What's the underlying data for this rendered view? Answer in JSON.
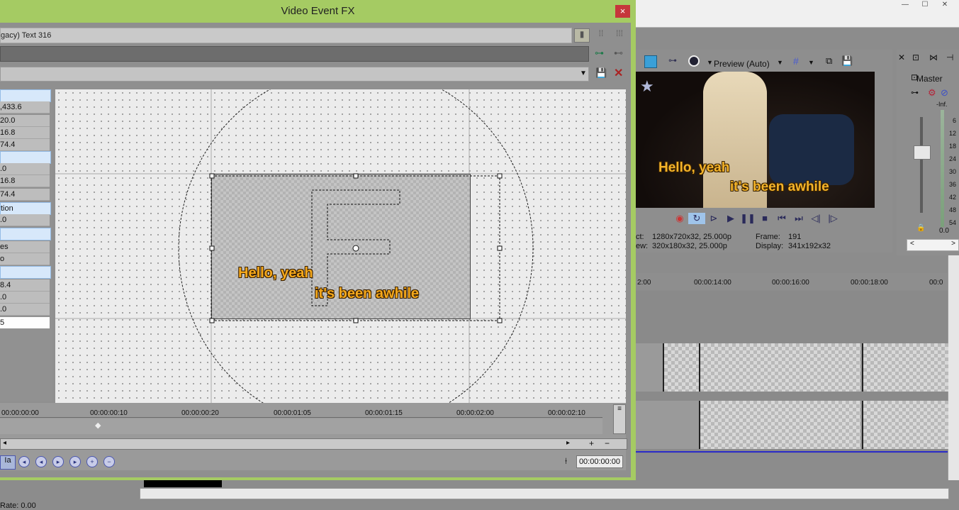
{
  "background_app": {
    "preview_mode": "Preview (Auto)",
    "captions": [
      "Hello, yeah",
      "it's been awhile"
    ],
    "info": {
      "project_label": "ct:",
      "project_value": "1280x720x32, 25.000p",
      "preview_label": "ew:",
      "preview_value": "320x180x32, 25.000p",
      "frame_label": "Frame:",
      "frame_value": "191",
      "display_label": "Display:",
      "display_value": "341x192x32"
    },
    "master": {
      "label": "Master",
      "meter_top": "-Inf.",
      "meter_scale": [
        "6",
        "12",
        "18",
        "24",
        "30",
        "36",
        "42",
        "48",
        "54"
      ],
      "meter_bottom": "0.0"
    },
    "timeline_ticks": [
      "2:00",
      "00:00:14:00",
      "00:00:16:00",
      "00:00:18:00",
      "00:0"
    ],
    "rate_label": "Rate: 0.00"
  },
  "fx_dialog": {
    "title": "Video Event FX",
    "close_label": "×",
    "plugin_name": "gacy) Text 316",
    "properties": [
      {
        "text": "",
        "kind": "hdr"
      },
      {
        "text": ",433.6",
        "kind": "val"
      },
      {
        "text": "20.0",
        "kind": "val"
      },
      {
        "text": "16.8",
        "kind": "val"
      },
      {
        "text": "74.4",
        "kind": "val"
      },
      {
        "text": "",
        "kind": "hdr"
      },
      {
        "text": ".0",
        "kind": "val"
      },
      {
        "text": "16.8",
        "kind": "val"
      },
      {
        "text": "74.4",
        "kind": "val"
      },
      {
        "text": "tion",
        "kind": "hdr"
      },
      {
        "text": ".0",
        "kind": "val"
      },
      {
        "text": "",
        "kind": "hdr"
      },
      {
        "text": "es",
        "kind": "val"
      },
      {
        "text": "o",
        "kind": "val"
      },
      {
        "text": "",
        "kind": "hdr"
      },
      {
        "text": "8.4",
        "kind": "val"
      },
      {
        "text": ".0",
        "kind": "val"
      },
      {
        "text": ".0",
        "kind": "val"
      },
      {
        "text": "5",
        "kind": "sel"
      }
    ],
    "canvas_captions": [
      "Hello, yeah",
      "it's been awhile"
    ],
    "keyframe_ticks": [
      "00:00:00:00",
      "00:00:00:10",
      "00:00:00:20",
      "00:00:01:05",
      "00:00:01:15",
      "00:00:02:00",
      "00:00:02:10"
    ],
    "cursor_time": "00:00:00:00"
  },
  "colors": {
    "dialog_frame": "#a5cb63",
    "close_button": "#c6363b",
    "caption": "#f5a91c"
  }
}
